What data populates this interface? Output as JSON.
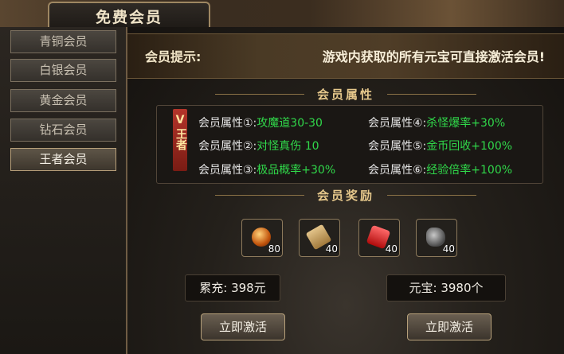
{
  "window": {
    "title": "免费会员"
  },
  "sidebar": {
    "items": [
      {
        "label": "青铜会员"
      },
      {
        "label": "白银会员"
      },
      {
        "label": "黄金会员"
      },
      {
        "label": "钻石会员"
      },
      {
        "label": "王者会员"
      }
    ]
  },
  "hint": {
    "label": "会员提示:",
    "text": "游戏内获取的所有元宝可直接激活会员!"
  },
  "attributes": {
    "title": "会员属性",
    "badge": {
      "tier": "V",
      "text": "王者"
    },
    "items": [
      {
        "label": "会员属性①:",
        "value": "攻魔道30-30"
      },
      {
        "label": "会员属性②:",
        "value": "对怪真伤 10"
      },
      {
        "label": "会员属性③:",
        "value": "极品概率+30%"
      },
      {
        "label": "会员属性④:",
        "value": "杀怪爆率+30%"
      },
      {
        "label": "会员属性⑤:",
        "value": "金币回收+100%"
      },
      {
        "label": "会员属性⑥:",
        "value": "经验倍率+100%"
      }
    ]
  },
  "rewards": {
    "title": "会员奖励",
    "items": [
      {
        "icon": "orb-icon",
        "count": "80"
      },
      {
        "icon": "scroll-icon",
        "count": "40"
      },
      {
        "icon": "red-gem-icon",
        "count": "40"
      },
      {
        "icon": "ore-icon",
        "count": "40"
      }
    ]
  },
  "stats": {
    "recharge": "累充: 398元",
    "yuanbao": "元宝: 3980个"
  },
  "buttons": {
    "activate_left": "立即激活",
    "activate_right": "立即激活"
  },
  "colors": {
    "attr_value": "#30d84a",
    "gold_text": "#e5c78b"
  }
}
